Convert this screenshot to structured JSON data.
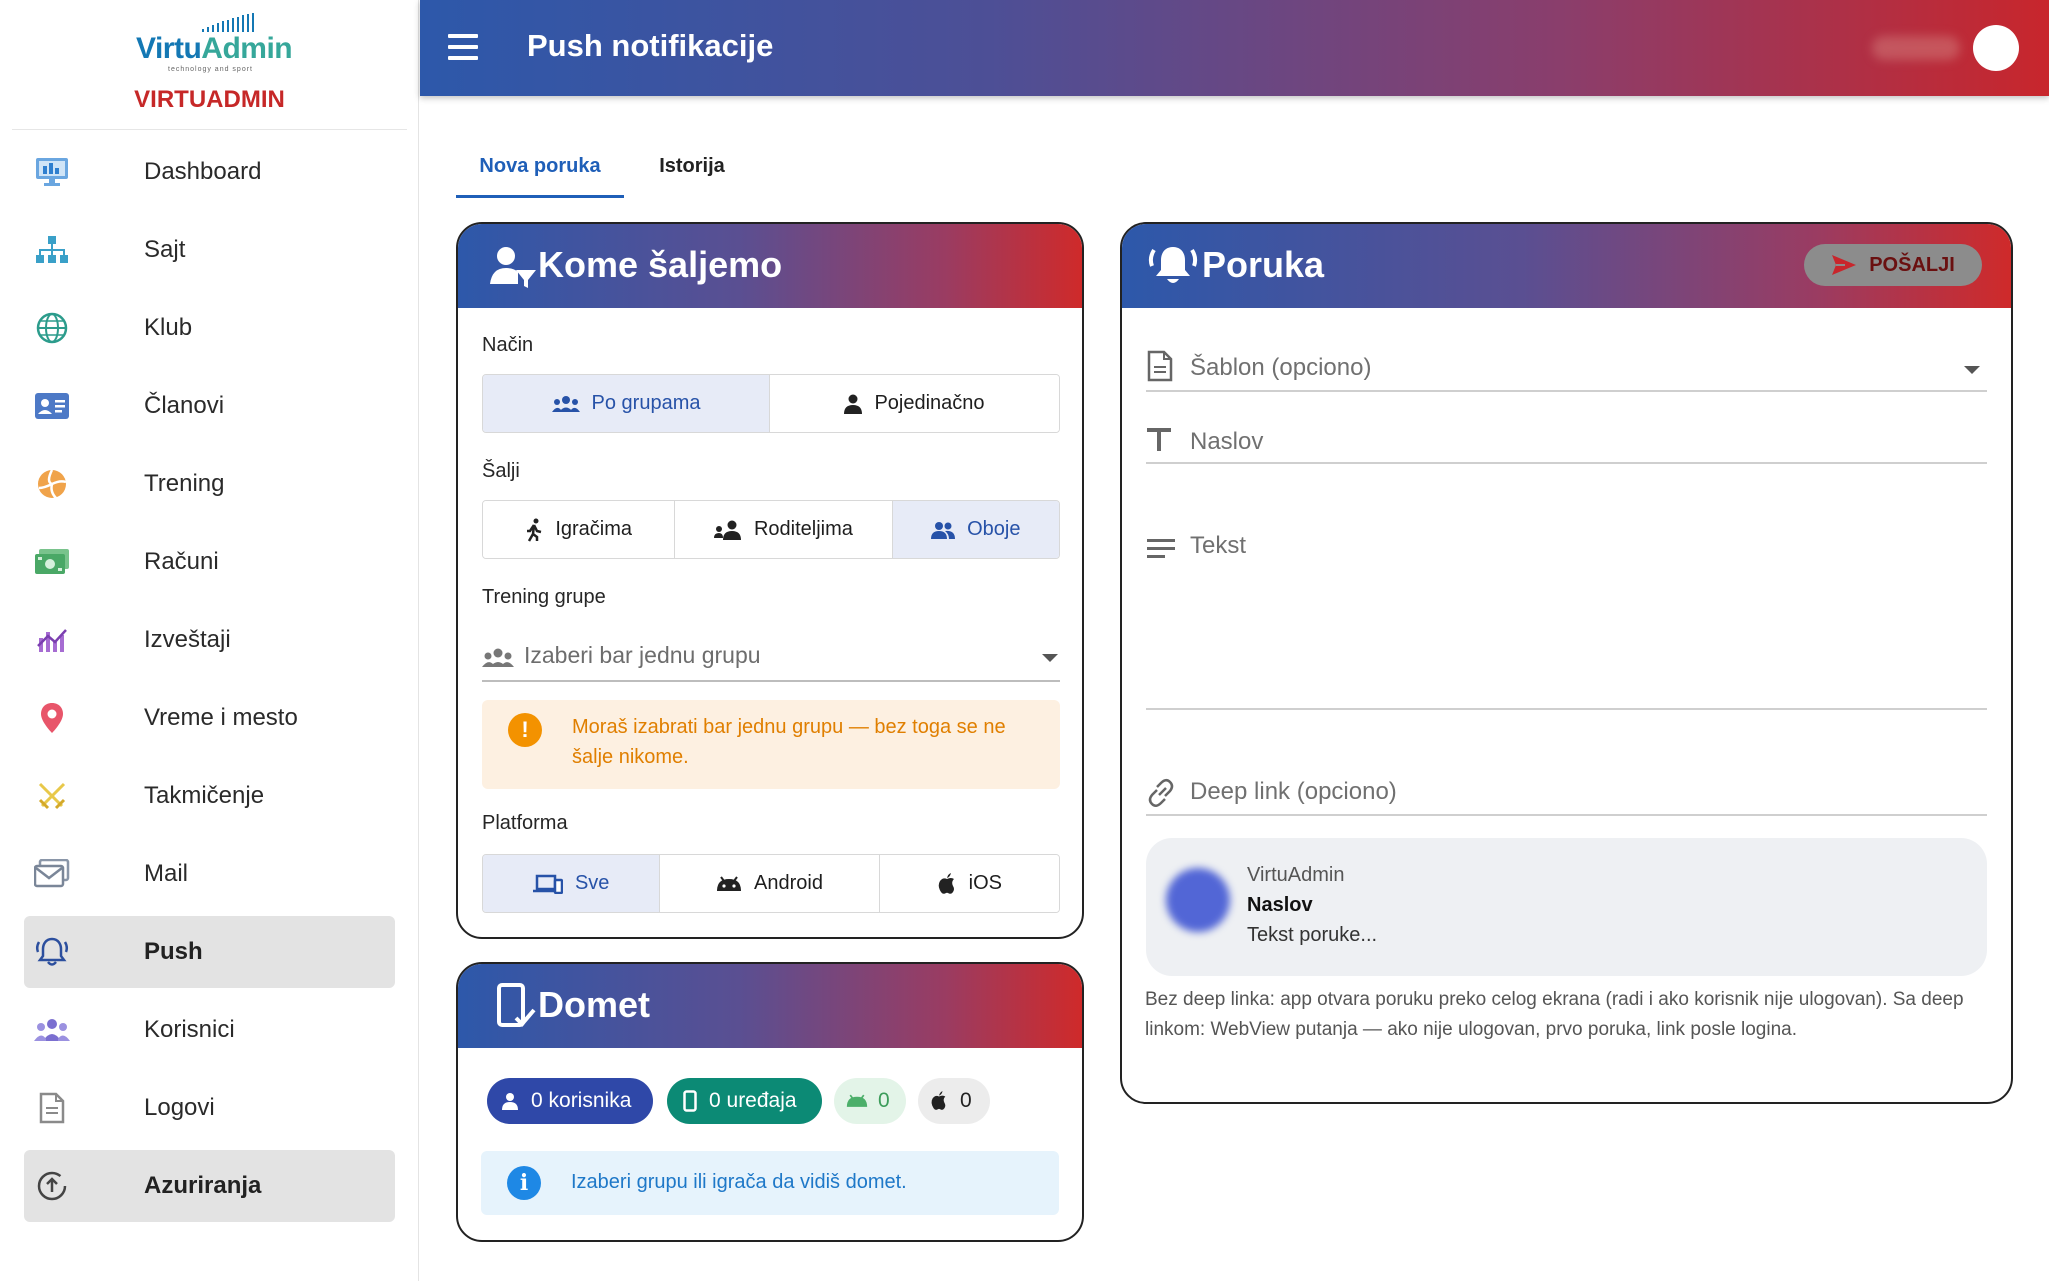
{
  "brand": {
    "logo_name_part1": "Virtu",
    "logo_name_part2": "Admin",
    "logo_tagline": "technology and sport",
    "caption": "VIRTUADMIN",
    "brand_color": "#c62828"
  },
  "sidebar": {
    "items": [
      {
        "label": "Dashboard",
        "icon": "monitor-icon"
      },
      {
        "label": "Sajt",
        "icon": "sitemap-icon"
      },
      {
        "label": "Klub",
        "icon": "globe-icon"
      },
      {
        "label": "Članovi",
        "icon": "id-card-icon"
      },
      {
        "label": "Trening",
        "icon": "volleyball-icon"
      },
      {
        "label": "Računi",
        "icon": "cash-icon"
      },
      {
        "label": "Izveštaji",
        "icon": "chart-icon"
      },
      {
        "label": "Vreme i mesto",
        "icon": "map-pin-icon"
      },
      {
        "label": "Takmičenje",
        "icon": "swords-icon"
      },
      {
        "label": "Mail",
        "icon": "mail-icon"
      },
      {
        "label": "Push",
        "icon": "bell-icon"
      },
      {
        "label": "Korisnici",
        "icon": "users-icon"
      },
      {
        "label": "Logovi",
        "icon": "document-icon"
      },
      {
        "label": "Azuriranja",
        "icon": "update-icon"
      }
    ],
    "active": [
      "Push",
      "Azuriranja"
    ]
  },
  "header": {
    "title": "Push notifikacije"
  },
  "tabs": [
    {
      "label": "Nova poruka",
      "selected": true
    },
    {
      "label": "Istorija",
      "selected": false
    }
  ],
  "audience": {
    "title": "Kome šaljemo",
    "mode_label": "Način",
    "mode_options": [
      "Po grupama",
      "Pojedinačno"
    ],
    "mode_selected": "Po grupama",
    "send_to_label": "Šalji",
    "send_to_options": [
      "Igračima",
      "Roditeljima",
      "Oboje"
    ],
    "send_to_selected": "Oboje",
    "groups_label": "Trening grupe",
    "groups_placeholder": "Izaberi bar jednu grupu",
    "warning": "Moraš izabrati bar jednu grupu — bez toga se ne šalje nikome.",
    "platform_label": "Platforma",
    "platform_options": [
      "Sve",
      "Android",
      "iOS"
    ],
    "platform_selected": "Sve"
  },
  "reach": {
    "title": "Domet",
    "users_chip": "0 korisnika",
    "devices_chip": "0 uređaja",
    "android_count": "0",
    "ios_count": "0",
    "info": "Izaberi grupu ili igrača da vidiš domet."
  },
  "message": {
    "title": "Poruka",
    "send_label": "POŠALJI",
    "template_placeholder": "Šablon (opciono)",
    "title_placeholder": "Naslov",
    "body_placeholder": "Tekst",
    "deeplink_placeholder": "Deep link (opciono)",
    "preview": {
      "app": "VirtuAdmin",
      "title": "Naslov",
      "body": "Tekst poruke..."
    },
    "help": "Bez deep linka: app otvara poruku preko celog ekrana (radi i ako korisnik nije ulogovan). Sa deep linkom: WebView putanja — ako nije ulogovan, prvo poruka, link posle logina."
  },
  "colors": {
    "accent": "#2752a8",
    "header_gradient_start": "#2d58aa",
    "header_gradient_end": "#c8262c",
    "warning": "#f39200",
    "info": "#1e88e5",
    "chip_users": "#2f48a8",
    "chip_devices": "#0c8a75"
  }
}
